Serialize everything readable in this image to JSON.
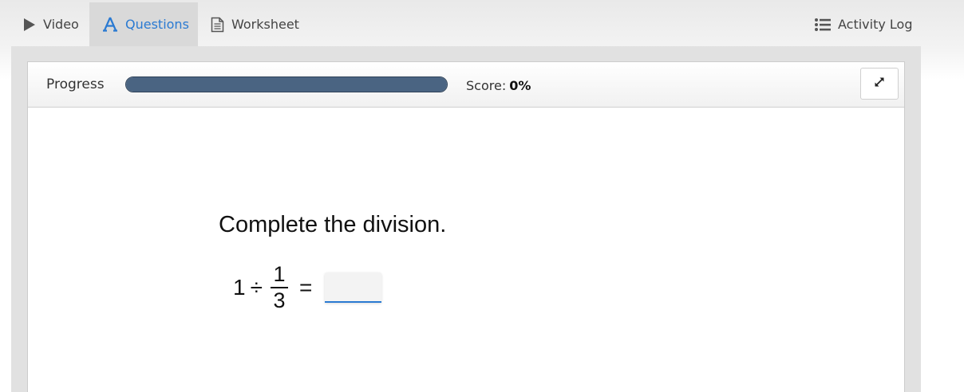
{
  "tabs": [
    {
      "label": "Video",
      "icon": "play-icon",
      "active": false
    },
    {
      "label": "Questions",
      "icon": "letter-a-icon",
      "active": true
    },
    {
      "label": "Worksheet",
      "icon": "document-icon",
      "active": false
    },
    {
      "label": "Activity Log",
      "icon": "list-icon",
      "active": false
    }
  ],
  "header": {
    "progress_label": "Progress",
    "progress_value": 0,
    "score_label": "Score:",
    "score_value": "0%"
  },
  "question": {
    "prompt": "Complete the division.",
    "dividend": "1",
    "operator": "÷",
    "numerator": "1",
    "denominator": "3",
    "equals": "=",
    "answer_value": ""
  },
  "colors": {
    "accent": "#2a7ad2",
    "progress_bar": "#4a6482",
    "active_tab_bg": "#d9d9d9"
  }
}
